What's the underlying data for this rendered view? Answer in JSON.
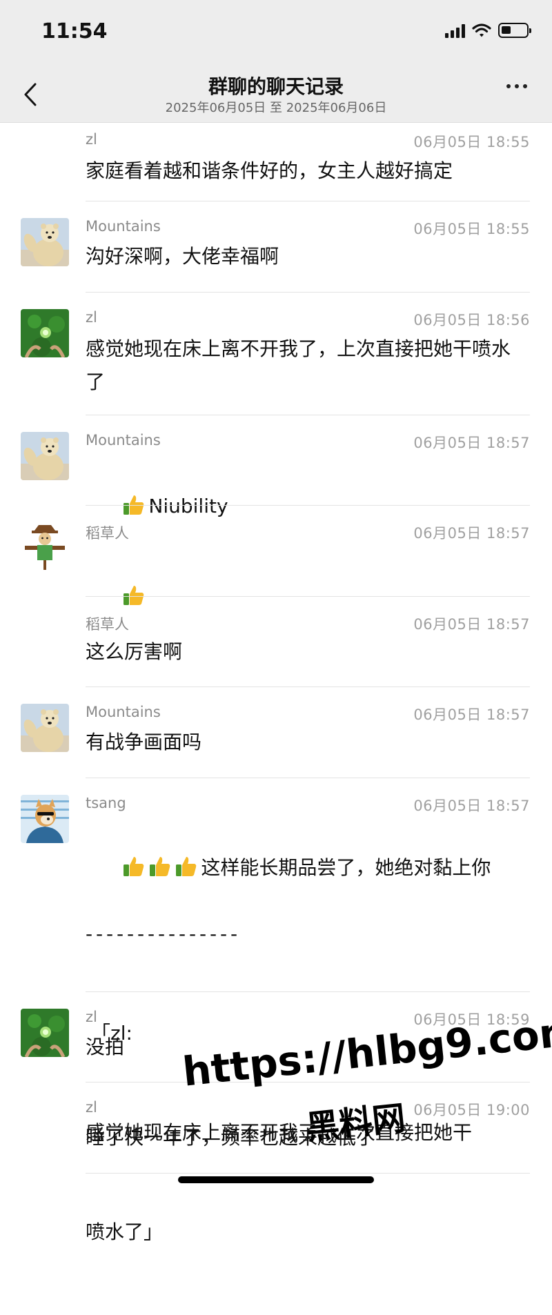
{
  "status_bar": {
    "time": "11:54"
  },
  "header": {
    "title": "群聊的聊天记录",
    "subtitle": "2025年06月05日 至 2025年06月06日"
  },
  "messages": [
    {
      "sender": "zl",
      "time": "06月05日 18:55",
      "text": "家庭看着越和谐条件好的，女主人越好搞定",
      "avatar": "none"
    },
    {
      "sender": "Mountains",
      "time": "06月05日 18:55",
      "text": "沟好深啊，大佬幸福啊",
      "avatar": "polar-bear"
    },
    {
      "sender": "zl",
      "time": "06月05日 18:56",
      "text": "感觉她现在床上离不开我了，上次直接把她干喷水了",
      "avatar": "green-leaf"
    },
    {
      "sender": "Mountains",
      "time": "06月05日 18:57",
      "text": "Niubility",
      "avatar": "polar-bear"
    },
    {
      "sender": "稻草人",
      "time": "06月05日 18:57",
      "text": "",
      "avatar": "scarecrow"
    },
    {
      "sender": "稻草人",
      "time": "06月05日 18:57",
      "text": "这么厉害啊",
      "avatar": "none"
    },
    {
      "sender": "Mountains",
      "time": "06月05日 18:57",
      "text": "有战争画面吗",
      "avatar": "polar-bear"
    },
    {
      "sender": "tsang",
      "time": "06月05日 18:57",
      "text": "这样能长期品尝了，她绝对黏上你",
      "divider": "- - - - - - - - - - - - - - -",
      "quote_line1": "「zl:",
      "quote_line2": "感觉她现在床上离不开我了，上次直接把她干",
      "quote_line3": "喷水了」",
      "avatar": "shiba-dog"
    },
    {
      "sender": "zl",
      "time": "06月05日 18:59",
      "text": "没拍",
      "avatar": "green-leaf"
    },
    {
      "sender": "zl",
      "time": "06月05日 19:00",
      "text": "睡了快一年了，频率也越来越低了",
      "avatar": "none"
    }
  ],
  "watermark": {
    "url": "https://hlbg9.com",
    "site": "黑料网"
  },
  "colors": {
    "header_bg": "#ededed",
    "meta_gray": "#a0a0a0",
    "separator": "#e3e3e3"
  },
  "icons": [
    "back-chevron-icon",
    "more-dots-icon",
    "thumbs-up-icon",
    "signal-icon",
    "wifi-icon",
    "battery-icon"
  ]
}
